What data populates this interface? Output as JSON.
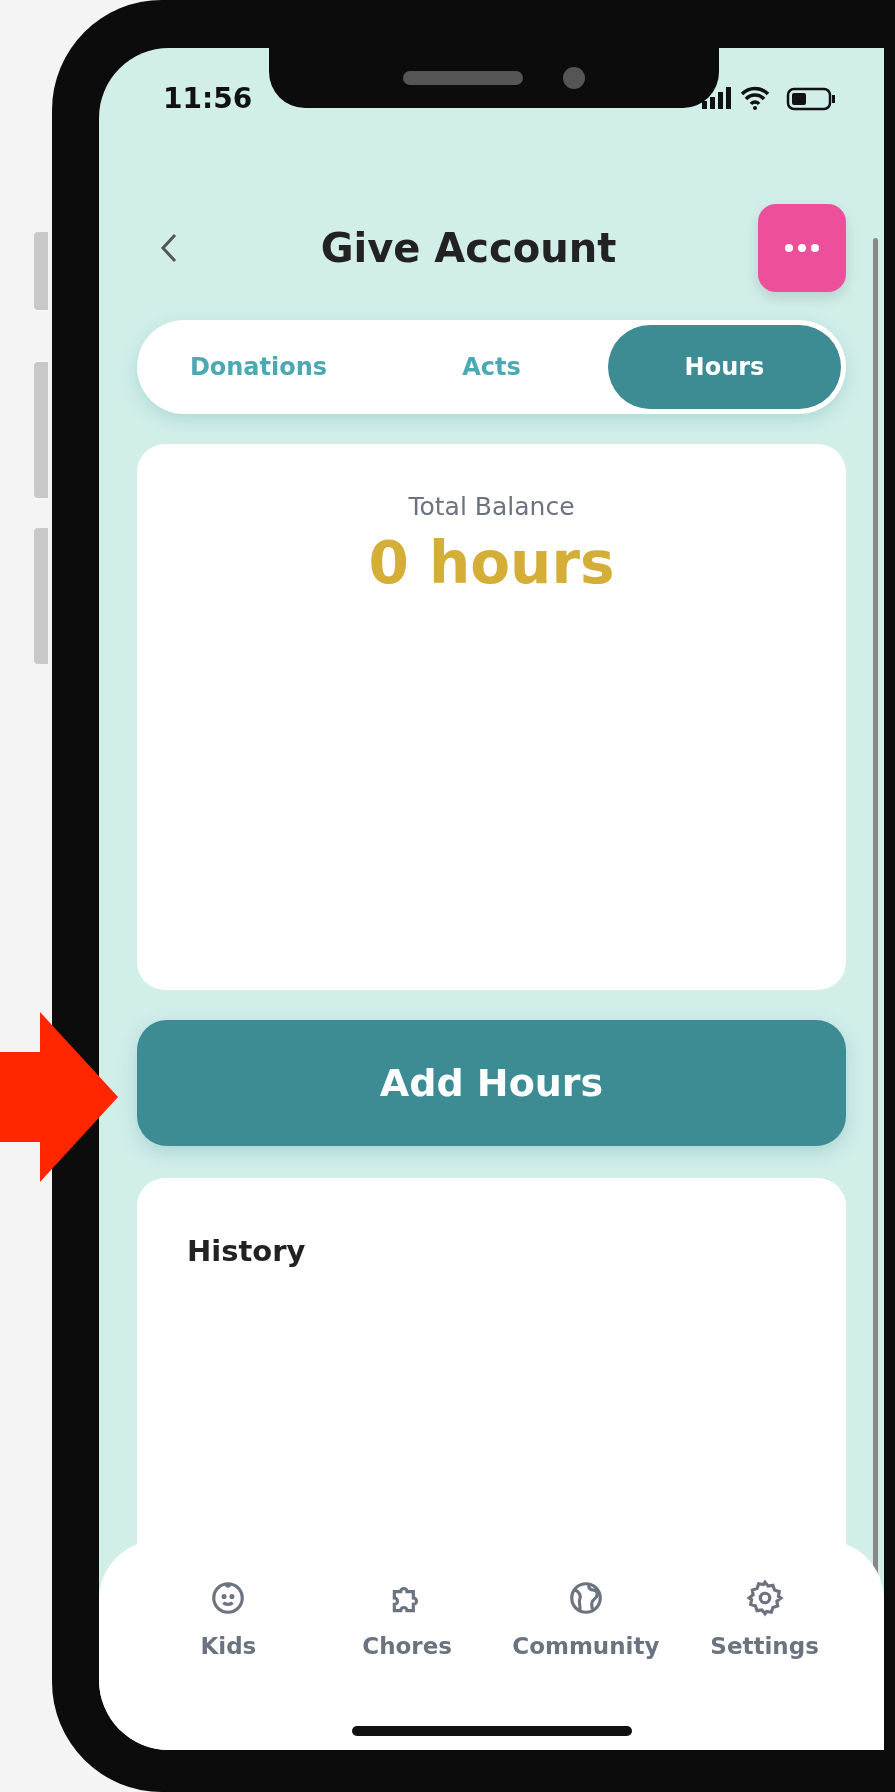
{
  "status_bar": {
    "time": "11:56"
  },
  "header": {
    "title": "Give Account"
  },
  "tabs": [
    {
      "label": "Donations",
      "selected": false
    },
    {
      "label": "Acts",
      "selected": false
    },
    {
      "label": "Hours",
      "selected": true
    }
  ],
  "balance": {
    "label": "Total Balance",
    "value": "0 hours"
  },
  "primary_action": {
    "label": "Add Hours"
  },
  "history": {
    "title": "History"
  },
  "bottom_nav": [
    {
      "label": "Kids"
    },
    {
      "label": "Chores"
    },
    {
      "label": "Community"
    },
    {
      "label": "Settings"
    }
  ]
}
